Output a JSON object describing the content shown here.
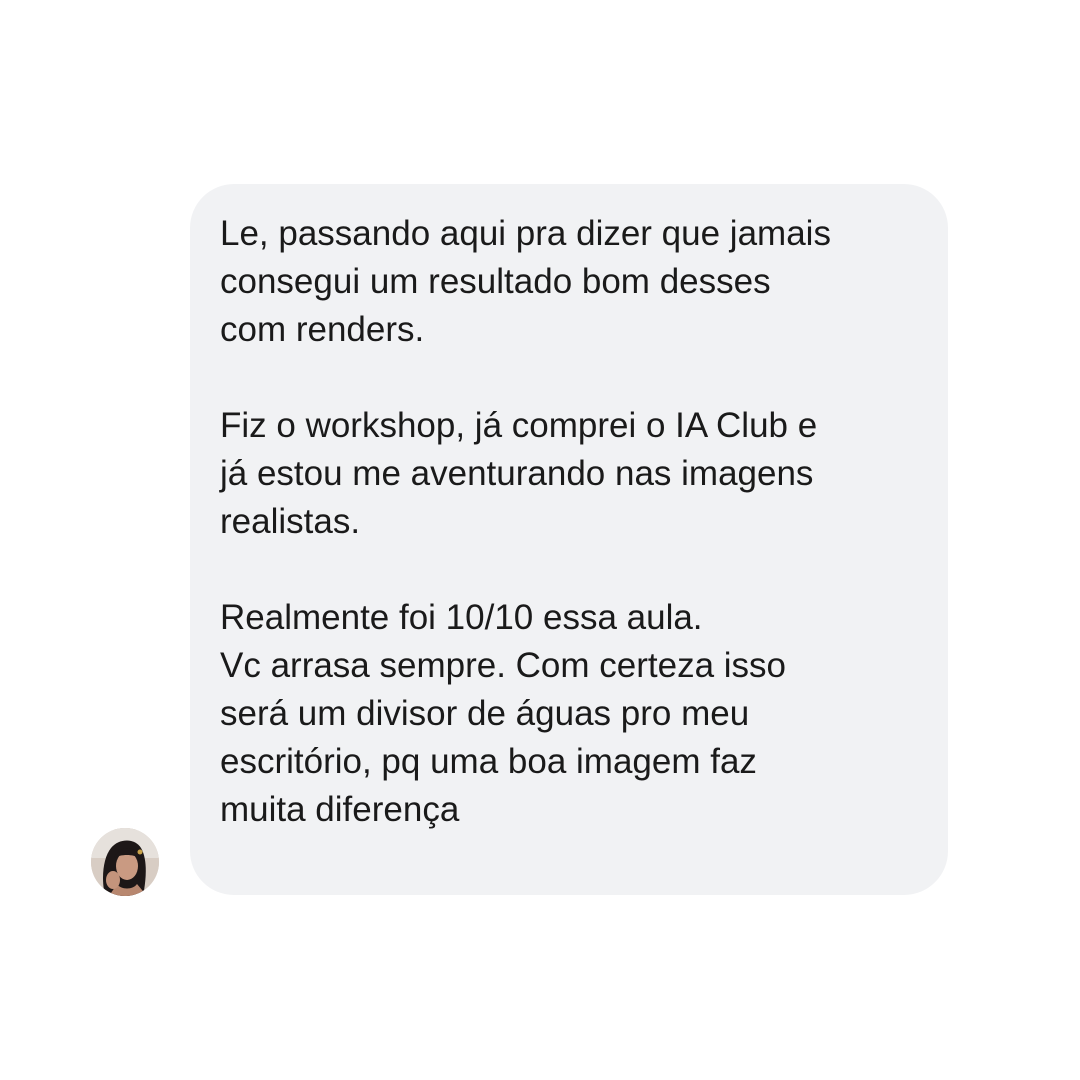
{
  "message": {
    "lines": [
      "Le, passando aqui pra dizer que jamais",
      "consegui um resultado bom desses",
      "com renders.",
      "",
      "Fiz o workshop, já comprei o IA Club e",
      "já estou me aventurando nas imagens",
      "realistas.",
      "",
      "Realmente foi 10/10 essa aula.",
      "Vc arrasa sempre. Com certeza isso",
      "será um divisor de águas pro meu",
      "escritório, pq uma boa imagem faz",
      "muita diferença"
    ]
  },
  "sender": {
    "avatar_icon": "user-avatar-photo"
  },
  "colors": {
    "background": "#ffffff",
    "bubble": "#f1f2f4",
    "text": "#1a1a1a"
  }
}
